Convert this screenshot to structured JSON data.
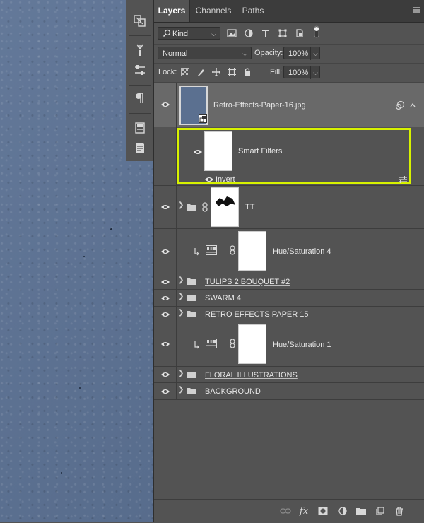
{
  "tabs": [
    {
      "label": "Layers",
      "active": true
    },
    {
      "label": "Channels",
      "active": false
    },
    {
      "label": "Paths",
      "active": false
    }
  ],
  "filter": {
    "kind_label": "Kind"
  },
  "blend": {
    "mode": "Normal",
    "opacity_label": "Opacity:",
    "opacity_value": "100%"
  },
  "lock": {
    "label": "Lock:",
    "fill_label": "Fill:",
    "fill_value": "100%"
  },
  "layers": {
    "l0_name": "Retro-Effects-Paper-16.jpg",
    "smart_filters_label": "Smart Filters",
    "invert_label": "Invert",
    "l1_name": "TT",
    "l2_name": "Hue/Saturation 4",
    "l3_name": "TULIPS 2 BOUQUET #2",
    "l4_name": "SWARM 4",
    "l5_name": "RETRO EFFECTS PAPER 15",
    "l6_name": "Hue/Saturation 1",
    "l7_name": "FLORAL ILLUSTRATIONS",
    "l8_name": "BACKGROUND"
  },
  "bottombar": {
    "fx_label": "fx"
  },
  "colors": {
    "highlight": "#d7f200",
    "panel": "#535353",
    "selected_row": "#696969",
    "canvas": "#5d7395"
  }
}
